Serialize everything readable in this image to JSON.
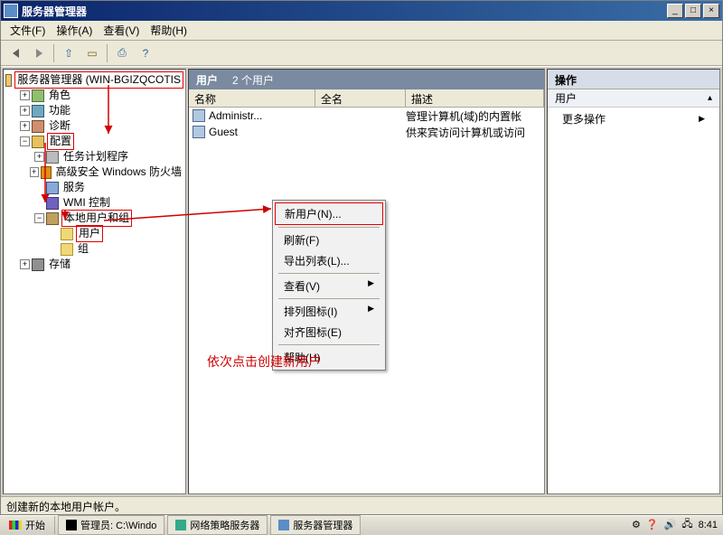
{
  "window": {
    "title": "服务器管理器"
  },
  "menu": {
    "file": "文件(F)",
    "action": "操作(A)",
    "view": "查看(V)",
    "help": "帮助(H)"
  },
  "tree": {
    "root": "服务器管理器 (WIN-BGIZQCOTIS",
    "roles": "角色",
    "features": "功能",
    "diag": "诊断",
    "config": "配置",
    "task": "任务计划程序",
    "firewall": "高级安全 Windows 防火墙",
    "services": "服务",
    "wmi": "WMI 控制",
    "localug": "本地用户和组",
    "users": "用户",
    "groups": "组",
    "storage": "存储"
  },
  "center": {
    "header": "用户",
    "count": "2 个用户",
    "cols": {
      "name": "名称",
      "fullname": "全名",
      "desc": "描述"
    },
    "rows": [
      {
        "name": "Administr...",
        "full": "",
        "desc": "管理计算机(域)的内置帐"
      },
      {
        "name": "Guest",
        "full": "",
        "desc": "供来宾访问计算机或访问"
      }
    ]
  },
  "context": {
    "newuser": "新用户(N)...",
    "refresh": "刷新(F)",
    "export": "导出列表(L)...",
    "view": "查看(V)",
    "arrange": "排列图标(I)",
    "align": "对齐图标(E)",
    "help": "帮助(H)"
  },
  "right": {
    "header": "操作",
    "sub": "用户",
    "more": "更多操作"
  },
  "annotation": "依次点击创建新用户",
  "status": "创建新的本地用户帐户。",
  "taskbar": {
    "start": "开始",
    "t1": "管理员: C:\\Windo",
    "t2": "网络策略服务器",
    "t3": "服务器管理器",
    "time": "8:41"
  }
}
